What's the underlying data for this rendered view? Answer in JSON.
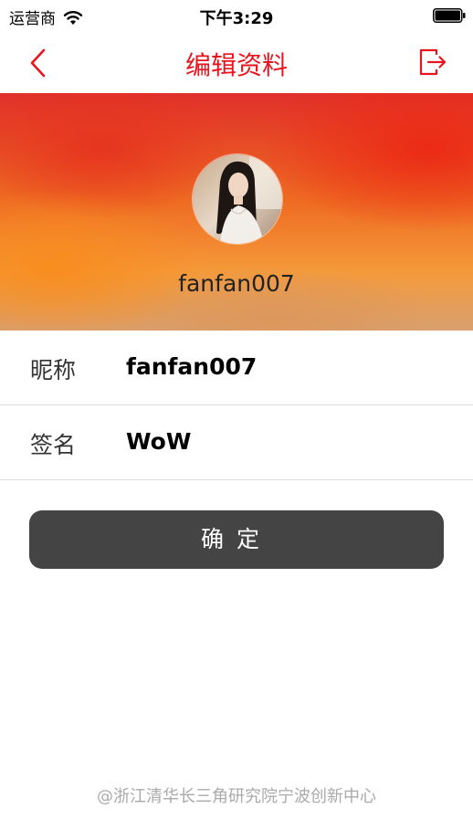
{
  "status_bar": {
    "carrier": "运营商",
    "time": "下午3:29",
    "icons": [
      "wifi-icon",
      "battery-icon"
    ]
  },
  "nav": {
    "title": "编辑资料",
    "back_icon": "chevron-left-icon",
    "exit_icon": "exit-icon",
    "accent_color": "#e8141e"
  },
  "profile": {
    "username": "fanfan007",
    "avatar_icon": "avatar"
  },
  "form": {
    "nickname": {
      "label": "昵称",
      "value": "fanfan007"
    },
    "signature": {
      "label": "签名",
      "value": "WoW"
    }
  },
  "confirm_button": {
    "label": "确定",
    "color": "#444444"
  },
  "footer": {
    "text": "@浙江清华长三角研究院宁波创新中心"
  }
}
